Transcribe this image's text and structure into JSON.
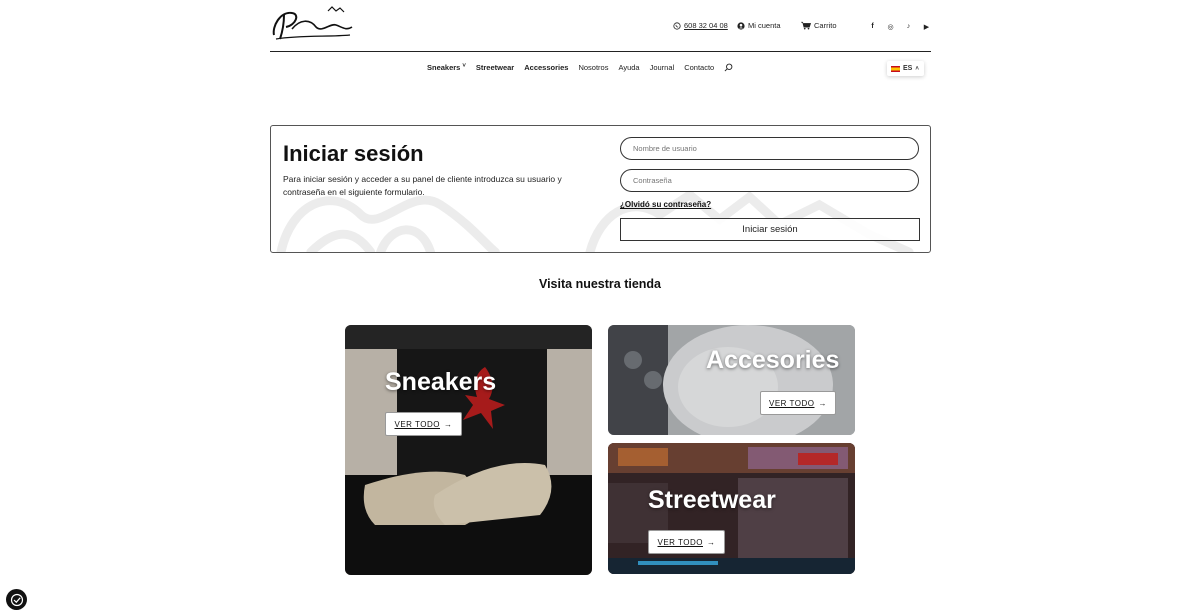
{
  "brand": {
    "logo_alt": "Sheetown"
  },
  "header": {
    "phone": "608 32 04 08",
    "account": "Mi cuenta",
    "cart": "Carrito",
    "social": [
      {
        "icon": "facebook-icon",
        "glyph": "f"
      },
      {
        "icon": "instagram-icon",
        "glyph": "◎"
      },
      {
        "icon": "tiktok-icon",
        "glyph": "♪"
      },
      {
        "icon": "youtube-icon",
        "glyph": "▶"
      }
    ]
  },
  "nav": {
    "items": [
      "Sneakers",
      "Streetwear",
      "Accessories",
      "Nosotros",
      "Ayuda",
      "Journal",
      "Contacto"
    ],
    "lang": "ES"
  },
  "login": {
    "title": "Iniciar sesión",
    "description": "Para iniciar sesión y acceder a su panel de cliente introduzca su usuario y contraseña en el siguiente formulario.",
    "username_placeholder": "Nombre de usuario",
    "password_placeholder": "Contraseña",
    "forgot": "¿Olvidó su contraseña?",
    "submit": "Iniciar sesión"
  },
  "store": {
    "title": "Visita nuestra tienda",
    "cards": [
      {
        "name": "Sneakers",
        "cta": "VER TODO"
      },
      {
        "name": "Accesories",
        "cta": "VER TODO"
      },
      {
        "name": "Streetwear",
        "cta": "VER TODO"
      }
    ],
    "arrow": "→"
  },
  "colors": {
    "text": "#111111",
    "border": "#333333",
    "background": "#ffffff"
  }
}
